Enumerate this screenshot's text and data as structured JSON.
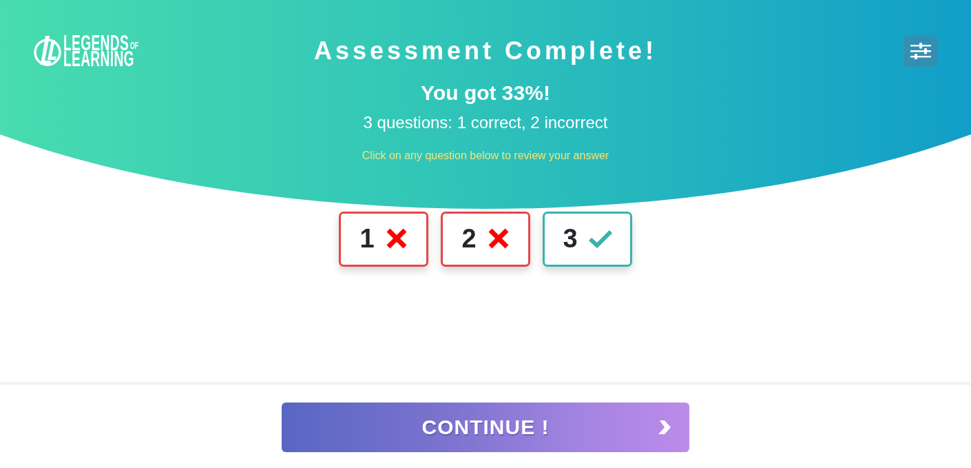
{
  "header": {
    "logo": {
      "line_1": "LEGENDS",
      "small": "OF",
      "line_2": "LEARNING"
    },
    "title": "Assessment Complete!",
    "score": "You got 33%!",
    "summary": "3 questions: 1 correct, 2 incorrect",
    "hint": "Click on any question below to review your answer"
  },
  "questions": [
    {
      "number": "1",
      "kind": "incorrect"
    },
    {
      "number": "2",
      "kind": "incorrect"
    },
    {
      "number": "3",
      "kind": "correct"
    }
  ],
  "continue_button": {
    "label": "CONTINUE !"
  }
}
